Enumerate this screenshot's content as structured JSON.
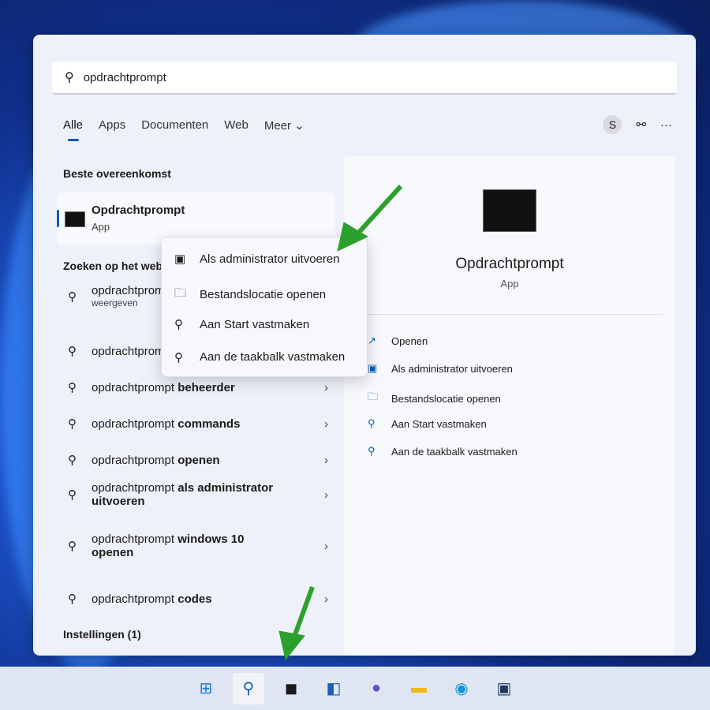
{
  "search": {
    "value": "opdrachtprompt"
  },
  "tabs": [
    {
      "label": "Alle"
    },
    {
      "label": "Apps"
    },
    {
      "label": "Documenten"
    },
    {
      "label": "Web"
    },
    {
      "label": "Meer ⌄"
    }
  ],
  "account_initial": "S",
  "best_match": {
    "heading": "Beste overeenkomst",
    "name": "Opdrachtprompt",
    "type": "App"
  },
  "web": {
    "heading": "Zoeken op het web",
    "items": [
      {
        "plain": "opdrachtprompt",
        "bold": "",
        "sub": "weergeven"
      },
      {
        "plain": "opdrachtprompt",
        "bold": "",
        "sub": ""
      },
      {
        "plain": "opdrachtprompt ",
        "bold": "beheerder",
        "sub": ""
      },
      {
        "plain": "opdrachtprompt ",
        "bold": "commands",
        "sub": ""
      },
      {
        "plain": "opdrachtprompt ",
        "bold": "openen",
        "sub": ""
      },
      {
        "plain": "opdrachtprompt ",
        "bold": "als administrator",
        "sub": "uitvoeren"
      },
      {
        "plain": "opdrachtprompt ",
        "bold": "windows 10",
        "sub": "openen"
      },
      {
        "plain": "opdrachtprompt ",
        "bold": "codes",
        "sub": ""
      }
    ]
  },
  "settings_heading": "Instellingen (1)",
  "detail": {
    "name": "Opdrachtprompt",
    "type": "App",
    "actions": [
      {
        "label": "Openen",
        "icon": "open-external-icon"
      },
      {
        "label": "Als administrator uitvoeren",
        "icon": "admin-shield-icon"
      },
      {
        "label": "Bestandslocatie openen",
        "icon": "folder-icon"
      },
      {
        "label": "Aan Start vastmaken",
        "icon": "pin-icon"
      },
      {
        "label": "Aan de taakbalk vastmaken",
        "icon": "pin-icon"
      }
    ]
  },
  "context_menu": [
    {
      "label": "Als administrator uitvoeren",
      "icon": "admin-shield-icon"
    },
    {
      "label": "Bestandslocatie openen",
      "icon": "folder-icon"
    },
    {
      "label": "Aan Start vastmaken",
      "icon": "pin-icon"
    },
    {
      "label": "Aan de taakbalk vastmaken",
      "icon": "pin-icon"
    }
  ],
  "taskbar": [
    "start-icon",
    "search-icon",
    "task-view-icon",
    "widgets-icon",
    "chat-icon",
    "file-explorer-icon",
    "edge-icon",
    "store-icon"
  ],
  "colors": {
    "accent": "#0a5cb3",
    "arrow": "#2ca02c"
  }
}
